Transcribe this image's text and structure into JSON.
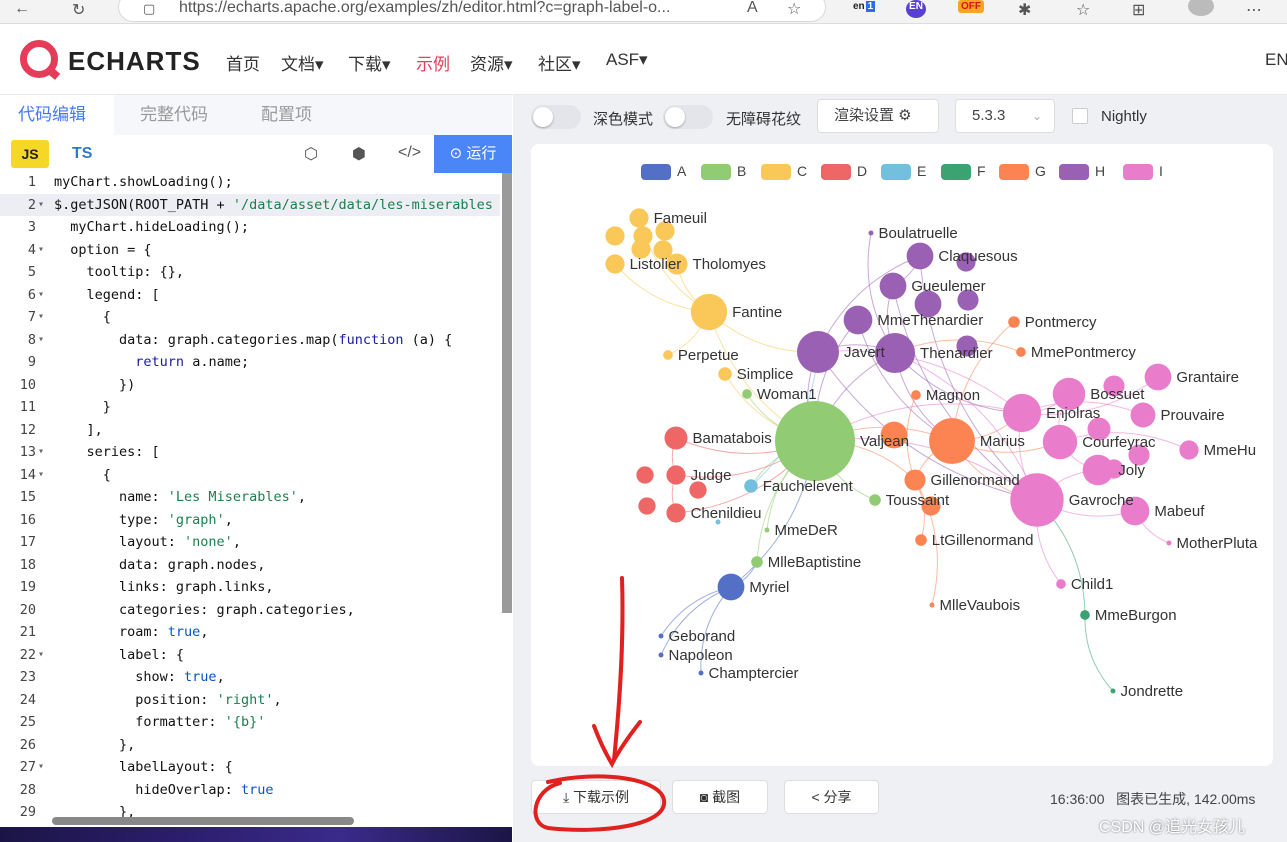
{
  "browser": {
    "url": "https://echarts.apache.org/examples/zh/editor.html?c=graph-label-o...",
    "ext_en1": "en",
    "ext_en1_count": "1",
    "ext_en2": "EN",
    "ext_off": "OFF"
  },
  "site_nav": {
    "logo": "ECHARTS",
    "items": [
      {
        "label": "首页"
      },
      {
        "label": "文档▾"
      },
      {
        "label": "下载▾"
      },
      {
        "label": "示例"
      },
      {
        "label": "资源▾"
      },
      {
        "label": "社区▾"
      },
      {
        "label": "ASF▾"
      }
    ],
    "lang": "EN"
  },
  "editor": {
    "tabs": [
      "代码编辑",
      "完整代码",
      "配置项"
    ],
    "js_label": "JS",
    "ts_label": "TS",
    "run_label": "运行",
    "code_lines": [
      {
        "n": "1",
        "fold": "",
        "html": "myChart.showLoading();"
      },
      {
        "n": "2",
        "fold": "▾",
        "html": "$.getJSON(ROOT_PATH + <span class='str'>'/data/asset/data/les-miserables</span>"
      },
      {
        "n": "3",
        "fold": "",
        "html": "  myChart.hideLoading();"
      },
      {
        "n": "4",
        "fold": "▾",
        "html": "  option = {"
      },
      {
        "n": "5",
        "fold": "",
        "html": "    tooltip: {},"
      },
      {
        "n": "6",
        "fold": "▾",
        "html": "    legend: ["
      },
      {
        "n": "7",
        "fold": "▾",
        "html": "      {"
      },
      {
        "n": "8",
        "fold": "▾",
        "html": "        data: graph.categories.map(<span class='kw'>function</span> (a) {"
      },
      {
        "n": "9",
        "fold": "",
        "html": "          <span class='kw'>return</span> a.name;"
      },
      {
        "n": "10",
        "fold": "",
        "html": "        })"
      },
      {
        "n": "11",
        "fold": "",
        "html": "      }"
      },
      {
        "n": "12",
        "fold": "",
        "html": "    ],"
      },
      {
        "n": "13",
        "fold": "▾",
        "html": "    series: ["
      },
      {
        "n": "14",
        "fold": "▾",
        "html": "      {"
      },
      {
        "n": "15",
        "fold": "",
        "html": "        name: <span class='str'>'Les Miserables'</span>,"
      },
      {
        "n": "16",
        "fold": "",
        "html": "        type: <span class='str'>'graph'</span>,"
      },
      {
        "n": "17",
        "fold": "",
        "html": "        layout: <span class='str'>'none'</span>,"
      },
      {
        "n": "18",
        "fold": "",
        "html": "        data: graph.nodes,"
      },
      {
        "n": "19",
        "fold": "",
        "html": "        links: graph.links,"
      },
      {
        "n": "20",
        "fold": "",
        "html": "        categories: graph.categories,"
      },
      {
        "n": "21",
        "fold": "",
        "html": "        roam: <span class='bool'>true</span>,"
      },
      {
        "n": "22",
        "fold": "▾",
        "html": "        label: {"
      },
      {
        "n": "23",
        "fold": "",
        "html": "          show: <span class='bool'>true</span>,"
      },
      {
        "n": "24",
        "fold": "",
        "html": "          position: <span class='str'>'right'</span>,"
      },
      {
        "n": "25",
        "fold": "",
        "html": "          formatter: <span class='str'>'{b}'</span>"
      },
      {
        "n": "26",
        "fold": "",
        "html": "        },"
      },
      {
        "n": "27",
        "fold": "▾",
        "html": "        labelLayout: {"
      },
      {
        "n": "28",
        "fold": "",
        "html": "          hideOverlap: <span class='bool'>true</span>"
      },
      {
        "n": "29",
        "fold": "",
        "html": "        },"
      }
    ]
  },
  "controls": {
    "dark_mode": "深色模式",
    "accessible_pattern": "无障碍花纹",
    "render_settings": "渲染设置 ⚙",
    "version": "5.3.3",
    "nightly": "Nightly"
  },
  "legend": [
    {
      "name": "A",
      "color": "#5470c6"
    },
    {
      "name": "B",
      "color": "#91cc75"
    },
    {
      "name": "C",
      "color": "#fac858"
    },
    {
      "name": "D",
      "color": "#ee6666"
    },
    {
      "name": "E",
      "color": "#73c0de"
    },
    {
      "name": "F",
      "color": "#3ba272"
    },
    {
      "name": "G",
      "color": "#fc8452"
    },
    {
      "name": "H",
      "color": "#9a60b4"
    },
    {
      "name": "I",
      "color": "#ea7ccc"
    }
  ],
  "chart_data": {
    "type": "graph",
    "nodes": [
      {
        "name": "Fameuil",
        "cat": 2,
        "val": 8
      },
      {
        "name": "Listolier",
        "cat": 2,
        "val": 8
      },
      {
        "name": "Tholomyes",
        "cat": 2,
        "val": 9
      },
      {
        "name": "Fantine",
        "cat": 2,
        "val": 17
      },
      {
        "name": "Perpetue",
        "cat": 2,
        "val": 3
      },
      {
        "name": "Simplice",
        "cat": 2,
        "val": 5
      },
      {
        "name": "Woman1",
        "cat": 1,
        "val": 3
      },
      {
        "name": "Valjean",
        "cat": 1,
        "val": 40
      },
      {
        "name": "Fauchelevent",
        "cat": 4,
        "val": 5
      },
      {
        "name": "Toussaint",
        "cat": 1,
        "val": 4
      },
      {
        "name": "MmeDeR",
        "cat": 1,
        "val": 2
      },
      {
        "name": "MlleBaptistine",
        "cat": 1,
        "val": 4
      },
      {
        "name": "Myriel",
        "cat": 0,
        "val": 12
      },
      {
        "name": "Geborand",
        "cat": 0,
        "val": 2
      },
      {
        "name": "Napoleon",
        "cat": 0,
        "val": 2
      },
      {
        "name": "Champtercier",
        "cat": 0,
        "val": 2
      },
      {
        "name": "Bamatabois",
        "cat": 3,
        "val": 10
      },
      {
        "name": "Judge",
        "cat": 3,
        "val": 8
      },
      {
        "name": "Chenildieu",
        "cat": 3,
        "val": 8
      },
      {
        "name": "Boulatruelle",
        "cat": 7,
        "val": 2
      },
      {
        "name": "Claquesous",
        "cat": 7,
        "val": 12
      },
      {
        "name": "Gueulemer",
        "cat": 7,
        "val": 12
      },
      {
        "name": "MmeThenardier",
        "cat": 7,
        "val": 13
      },
      {
        "name": "Javert",
        "cat": 7,
        "val": 20
      },
      {
        "name": "Thenardier",
        "cat": 7,
        "val": 19
      },
      {
        "name": "Pontmercy",
        "cat": 6,
        "val": 4
      },
      {
        "name": "MmePontmercy",
        "cat": 6,
        "val": 3
      },
      {
        "name": "Magnon",
        "cat": 6,
        "val": 3
      },
      {
        "name": "Marius",
        "cat": 6,
        "val": 22
      },
      {
        "name": "Gillenormand",
        "cat": 6,
        "val": 9
      },
      {
        "name": "LtGillenormand",
        "cat": 6,
        "val": 4
      },
      {
        "name": "MlleVaubois",
        "cat": 6,
        "val": 2
      },
      {
        "name": "Enjolras",
        "cat": 8,
        "val": 18
      },
      {
        "name": "Bossuet",
        "cat": 8,
        "val": 15
      },
      {
        "name": "Grantaire",
        "cat": 8,
        "val": 12
      },
      {
        "name": "Prouvaire",
        "cat": 8,
        "val": 11
      },
      {
        "name": "Courfeyrac",
        "cat": 8,
        "val": 16
      },
      {
        "name": "Joly",
        "cat": 8,
        "val": 14
      },
      {
        "name": "MmeHu",
        "cat": 8,
        "val": 8
      },
      {
        "name": "Gavroche",
        "cat": 8,
        "val": 26
      },
      {
        "name": "Mabeuf",
        "cat": 8,
        "val": 13
      },
      {
        "name": "MotherPluta",
        "cat": 8,
        "val": 2
      },
      {
        "name": "Child1",
        "cat": 8,
        "val": 3
      },
      {
        "name": "MmeBurgon",
        "cat": 5,
        "val": 3
      },
      {
        "name": "Jondrette",
        "cat": 5,
        "val": 2
      }
    ]
  },
  "footer": {
    "download": "下载示例",
    "screenshot": "截图",
    "share": "分享",
    "time": "16:36:00",
    "status": "图表已生成, 142.00ms",
    "watermark": "CSDN @追光女孩儿"
  }
}
